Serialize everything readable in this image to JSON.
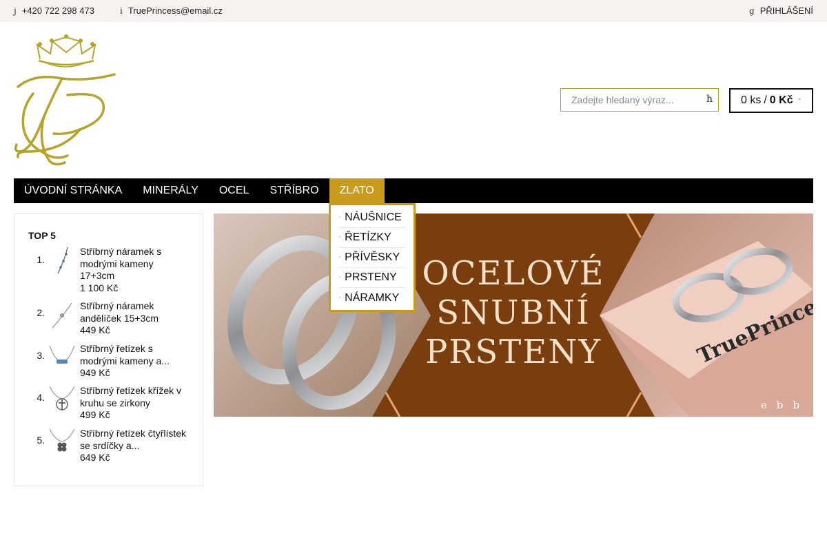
{
  "topbar": {
    "phone_icon": "j",
    "phone": "+420 722 298 473",
    "email_icon": "i",
    "email": "TruePrincess@email.cz",
    "login_icon": "g",
    "login": "PŘIHLÁŠENÍ"
  },
  "search": {
    "placeholder": "Zadejte hledaný výraz...",
    "button_glyph": "h"
  },
  "cart": {
    "count": "0 ks",
    "sep": "/",
    "price": "0 Kč",
    "icon_glyph": "\""
  },
  "nav": {
    "items": [
      "Úvodní stránka",
      "Minerály",
      "Ocel",
      "Stříbro",
      "Zlato"
    ],
    "active_index": 4
  },
  "dropdown": {
    "items": [
      "NÁUŠNICE",
      "ŘETÍZKY",
      "PŘÍVĚSKY",
      "PRSTENY",
      "NÁRAMKY"
    ]
  },
  "top5": {
    "title": "TOP 5",
    "items": [
      {
        "num": "1.",
        "name": "Stříbrný náramek s modrými kameny 17+3cm",
        "price": "1 100 Kč"
      },
      {
        "num": "2.",
        "name": "Stříbrný náramek andělíček 15+3cm",
        "price": "449 Kč"
      },
      {
        "num": "3.",
        "name": "Stříbrný řetízek s modrými kameny a...",
        "price": "949 Kč"
      },
      {
        "num": "4.",
        "name": "Stříbrný řetízek křížek v kruhu se zirkony",
        "price": "499 Kč"
      },
      {
        "num": "5.",
        "name": "Stříbrný řetízek čtyřlístek se srdíčky a...",
        "price": "649 Kč"
      }
    ]
  },
  "banner": {
    "line1": "OCELOVÉ",
    "line2": "SNUBNÍ",
    "line3": "PRSTENY",
    "box_text": "TruePrincess",
    "dots": [
      "e",
      "b",
      "b"
    ]
  },
  "colors": {
    "gold": "#c99b1a",
    "logo_gold": "#b6a42a",
    "banner_brown": "#7a3d0e"
  }
}
